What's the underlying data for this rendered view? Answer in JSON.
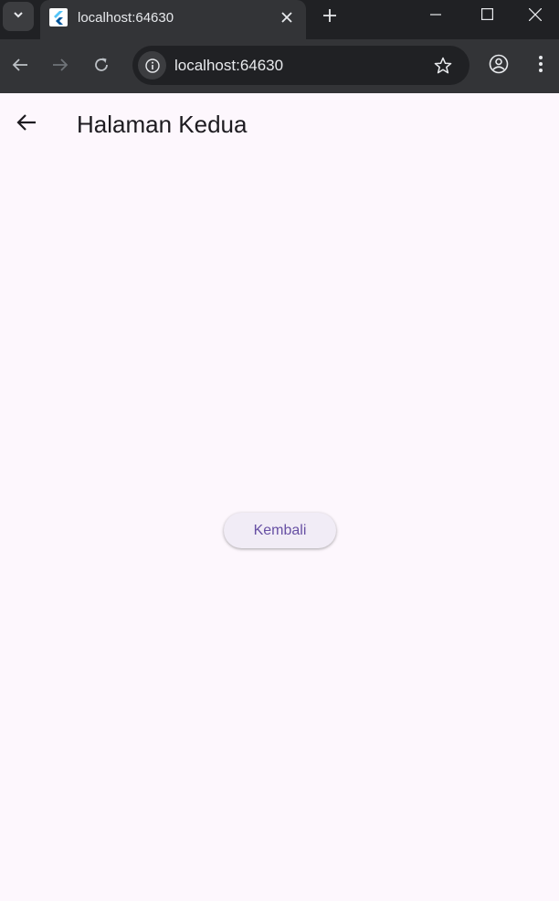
{
  "browser": {
    "tab_title": "localhost:64630",
    "url": "localhost:64630"
  },
  "app": {
    "page_title": "Halaman Kedua",
    "back_button_label": "Kembali"
  },
  "colors": {
    "page_background": "#fdf7fd",
    "button_text": "#6750a4",
    "button_background": "#f1ecf6",
    "browser_dark": "#202124",
    "browser_toolbar": "#333437"
  }
}
